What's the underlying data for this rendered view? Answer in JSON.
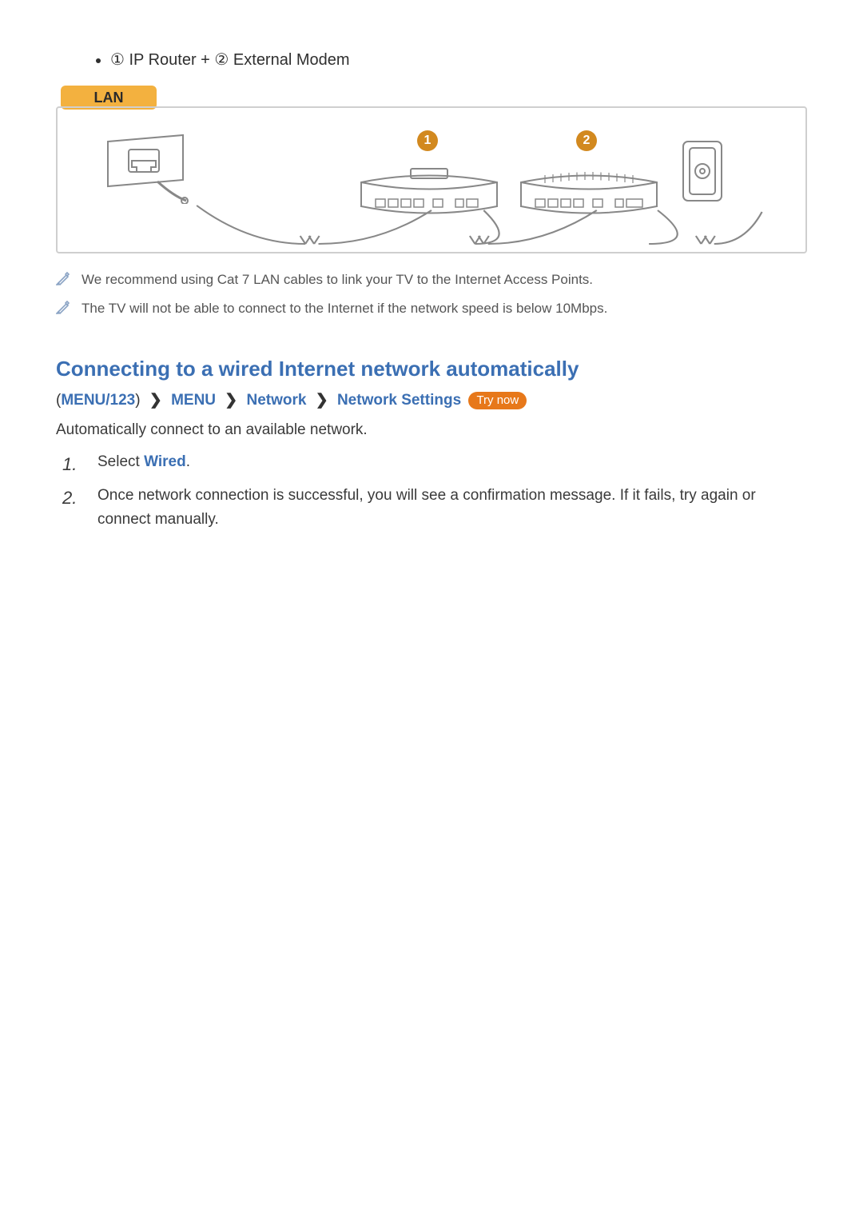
{
  "bullet": {
    "circ1": "①",
    "part1": " IP Router + ",
    "circ2": "②",
    "part2": " External Modem"
  },
  "diagram": {
    "lan_label": "LAN",
    "callout1": "1",
    "callout2": "2"
  },
  "notes": {
    "n1": "We recommend using Cat 7 LAN cables to link your TV to the Internet Access Points.",
    "n2": "The TV will not be able to connect to the Internet if the network speed is below 10Mbps."
  },
  "section_heading": "Connecting to a wired Internet network automatically",
  "breadcrumb": {
    "paren_open": "(",
    "menu123": "MENU/123",
    "paren_close": ")",
    "menu": "MENU",
    "network": "Network",
    "network_settings": "Network Settings",
    "chevron": "❯",
    "try_now": "Try now"
  },
  "intro": "Automatically connect to an available network.",
  "steps": {
    "s1_prefix": "Select ",
    "s1_kw": "Wired",
    "s1_suffix": ".",
    "s2": "Once network connection is successful, you will see a confirmation message. If it fails, try again or connect manually."
  }
}
